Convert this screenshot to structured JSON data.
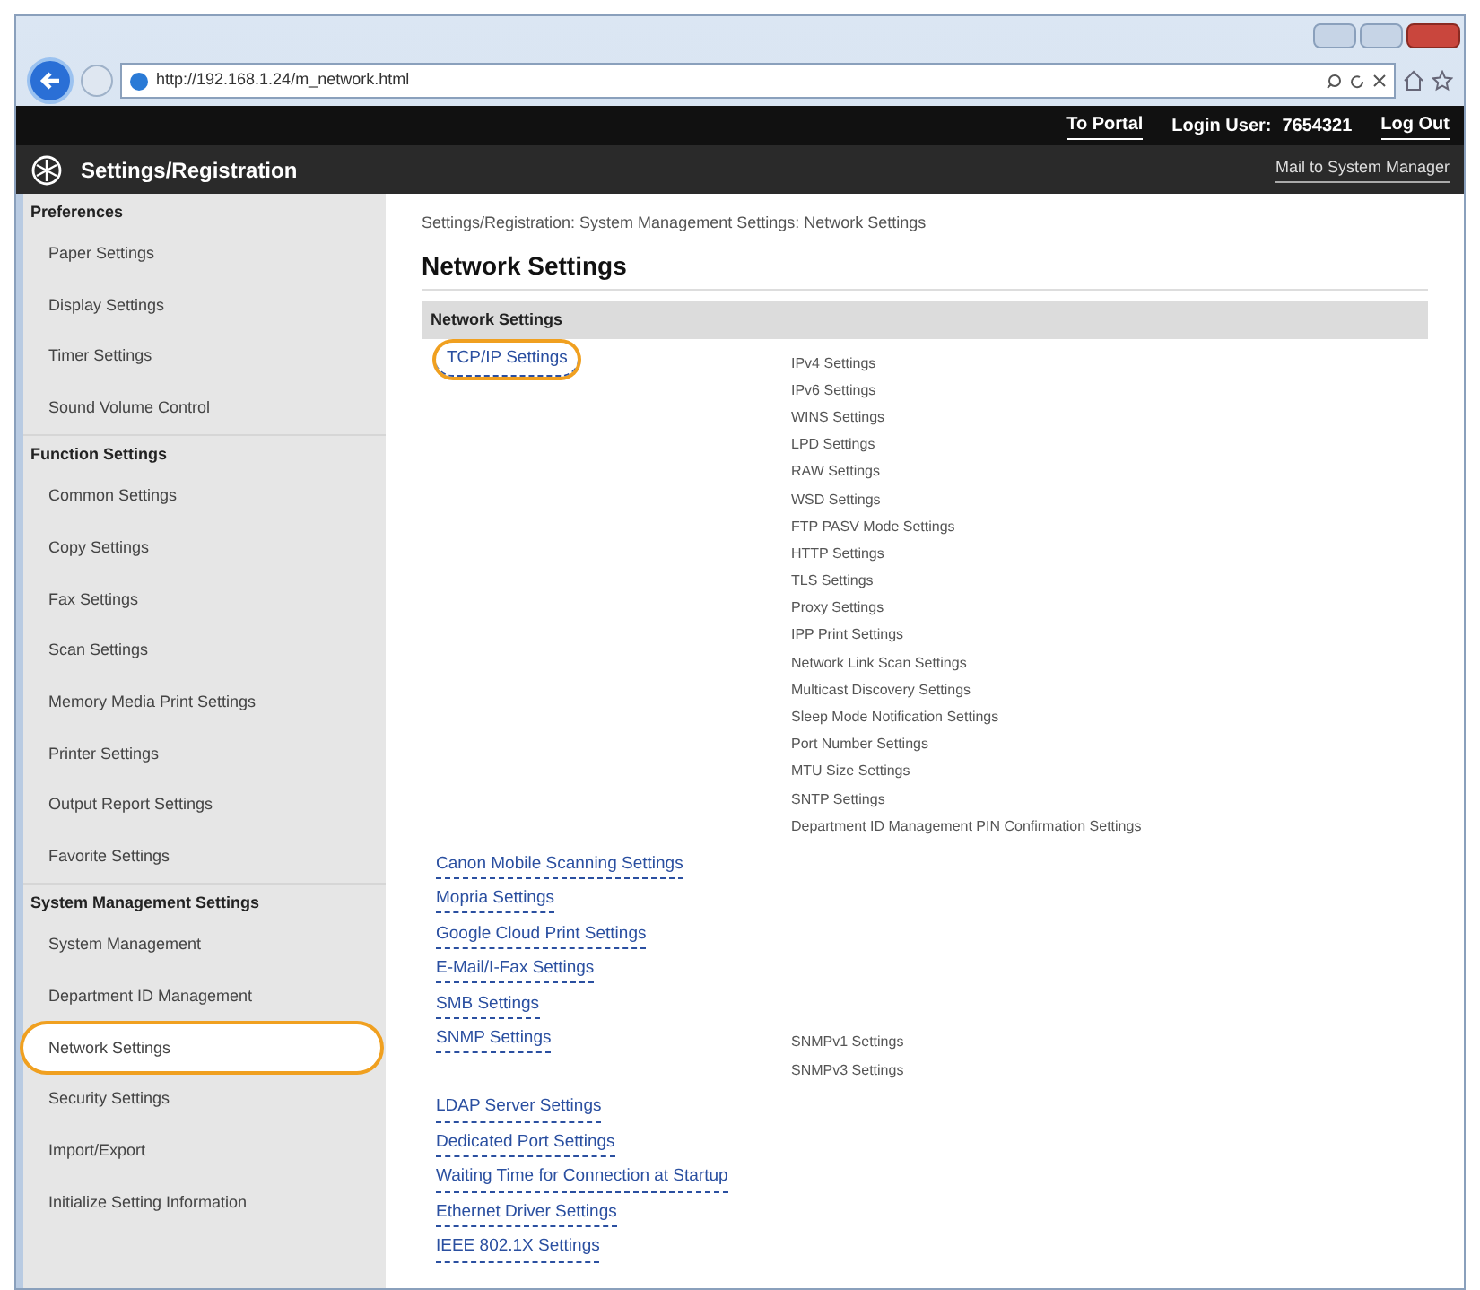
{
  "browser": {
    "url": "http://192.168.1.24/m_network.html"
  },
  "header": {
    "links": [
      "To Portal",
      "Log Out"
    ],
    "login_label": "Login User:",
    "login_user": "7654321",
    "title": "Settings/Registration",
    "mail_link": "Mail to System Manager"
  },
  "sidebar": {
    "sections": [
      {
        "heading": "Preferences",
        "items": [
          {
            "label": "Paper Settings",
            "selected": false,
            "highlighted": false
          },
          {
            "label": "Display Settings",
            "selected": false,
            "highlighted": false
          },
          {
            "label": "Timer Settings",
            "selected": false,
            "highlighted": false
          },
          {
            "label": "Sound Volume Control",
            "selected": false,
            "highlighted": false
          }
        ]
      },
      {
        "heading": "Function Settings",
        "items": [
          {
            "label": "Common Settings",
            "selected": false,
            "highlighted": false
          },
          {
            "label": "Copy Settings",
            "selected": false,
            "highlighted": false
          },
          {
            "label": "Fax Settings",
            "selected": false,
            "highlighted": false
          },
          {
            "label": "Scan Settings",
            "selected": false,
            "highlighted": false
          },
          {
            "label": "Memory Media Print Settings",
            "selected": false,
            "highlighted": false
          },
          {
            "label": "Printer Settings",
            "selected": false,
            "highlighted": false
          },
          {
            "label": "Output Report Settings",
            "selected": false,
            "highlighted": false
          },
          {
            "label": "Favorite Settings",
            "selected": false,
            "highlighted": false
          }
        ]
      },
      {
        "heading": "System Management Settings",
        "items": [
          {
            "label": "System Management",
            "selected": false,
            "highlighted": false
          },
          {
            "label": "Department ID Management",
            "selected": false,
            "highlighted": false
          },
          {
            "label": "Network Settings",
            "selected": true,
            "highlighted": true
          },
          {
            "label": "Security Settings",
            "selected": false,
            "highlighted": false
          },
          {
            "label": "Import/Export",
            "selected": false,
            "highlighted": false
          },
          {
            "label": "Initialize Setting Information",
            "selected": false,
            "highlighted": false
          }
        ]
      }
    ]
  },
  "content": {
    "breadcrumb": "Settings/Registration: System Management Settings: Network Settings",
    "title": "Network Settings",
    "section": "Network Settings",
    "entries": [
      {
        "link": "TCP/IP Settings",
        "highlighted": true,
        "subitems": [
          "IPv4 Settings",
          "IPv6 Settings",
          "WINS Settings",
          "LPD Settings",
          "RAW Settings",
          "WSD Settings",
          "FTP PASV Mode Settings",
          "HTTP Settings",
          "TLS Settings",
          "Proxy Settings",
          "IPP Print Settings",
          "Network Link Scan Settings",
          "Multicast Discovery Settings",
          "Sleep Mode Notification Settings",
          "Port Number Settings",
          "MTU Size Settings",
          "SNTP Settings",
          "Department ID Management PIN Confirmation Settings"
        ]
      },
      {
        "link": "Canon Mobile Scanning Settings",
        "highlighted": false
      },
      {
        "link": "Mopria Settings",
        "highlighted": false
      },
      {
        "link": "Google Cloud Print Settings",
        "highlighted": false
      },
      {
        "link": "E-Mail/I-Fax Settings",
        "highlighted": false
      },
      {
        "link": "SMB Settings",
        "highlighted": false
      },
      {
        "link": "SNMP Settings",
        "highlighted": false,
        "subitems": [
          "SNMPv1 Settings",
          "SNMPv3 Settings"
        ]
      },
      {
        "link": "LDAP Server Settings",
        "highlighted": false
      },
      {
        "link": "Dedicated Port Settings",
        "highlighted": false
      },
      {
        "link": "Waiting Time for Connection at Startup",
        "highlighted": false
      },
      {
        "link": "Ethernet Driver Settings",
        "highlighted": false
      },
      {
        "link": "IEEE 802.1X Settings",
        "highlighted": false
      }
    ]
  }
}
